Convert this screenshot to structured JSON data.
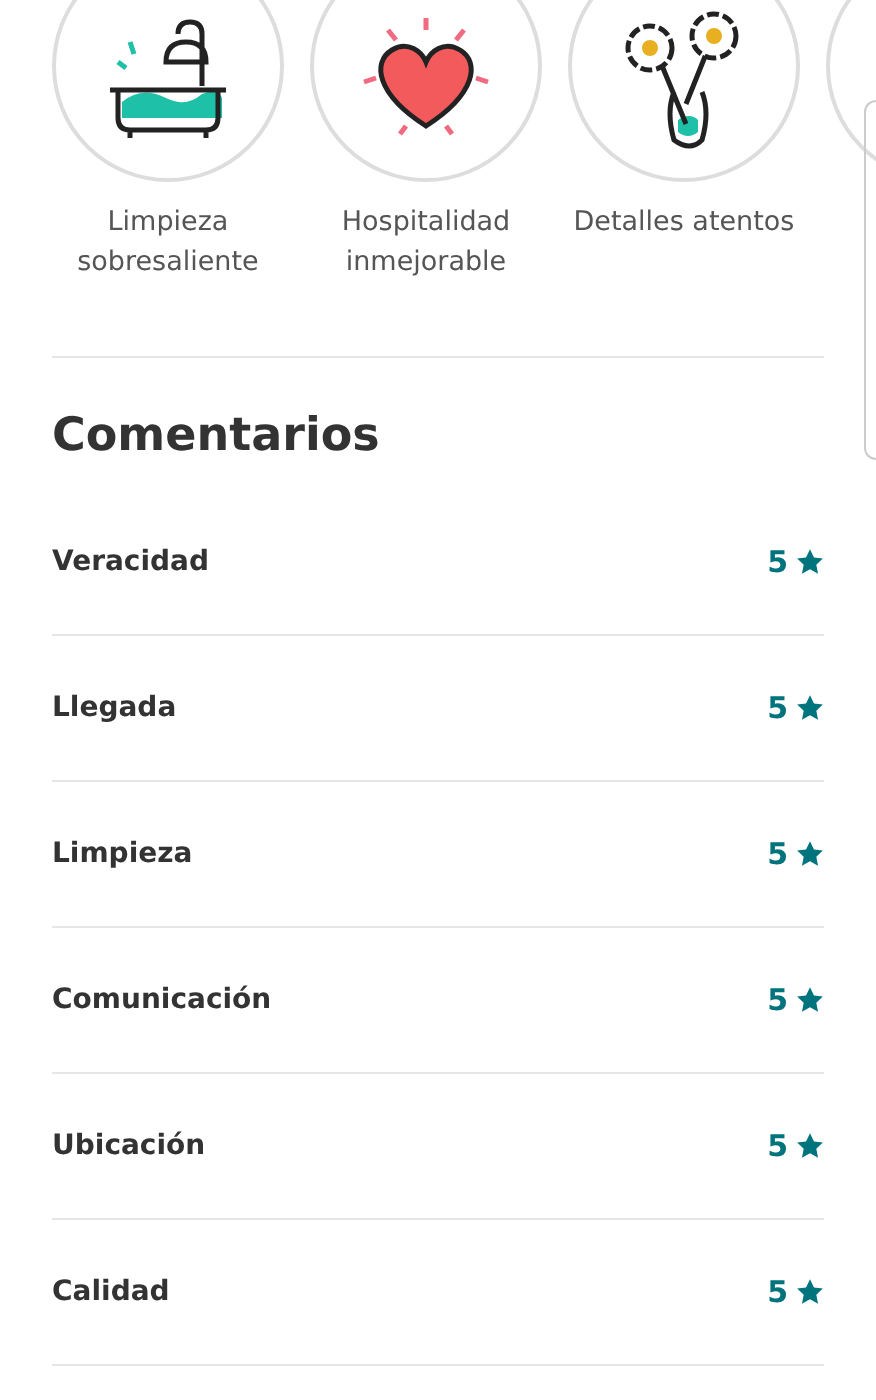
{
  "highlights": [
    {
      "kind": "bathtub",
      "label": "Limpieza sobresaliente"
    },
    {
      "kind": "heart",
      "label": "Hospitalidad inmejorable"
    },
    {
      "kind": "flowers",
      "label": "Detalles atentos"
    },
    {
      "kind": "other"
    }
  ],
  "reviews": {
    "title": "Comentarios",
    "ratings": [
      {
        "name": "Veracidad",
        "score": "5"
      },
      {
        "name": "Llegada",
        "score": "5"
      },
      {
        "name": "Limpieza",
        "score": "5"
      },
      {
        "name": "Comunicación",
        "score": "5"
      },
      {
        "name": "Ubicación",
        "score": "5"
      },
      {
        "name": "Calidad",
        "score": "5"
      }
    ]
  }
}
